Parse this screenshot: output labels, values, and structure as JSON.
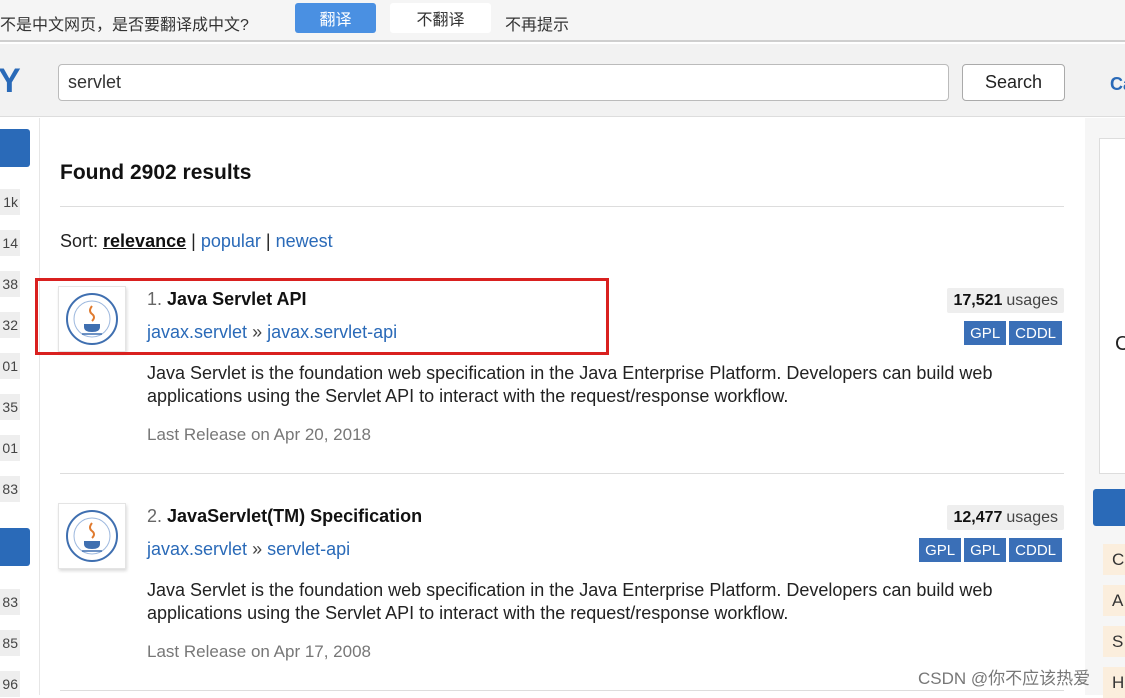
{
  "translate_bar": {
    "prompt": "不是中文网页，是否要翻译成中文?",
    "translate_button": "翻译",
    "no_button": "不翻译",
    "never_label": "不再提示"
  },
  "header": {
    "logo_fragment": "Y",
    "search_value": "servlet",
    "search_button": "Search",
    "right_fragment": "Ca"
  },
  "left_sidebar": {
    "counts_group_1": [
      "1k",
      "14",
      "38",
      "32",
      "01",
      "35",
      "01",
      "83"
    ],
    "counts_group_2": [
      "83",
      "85",
      "96"
    ]
  },
  "results_header": {
    "found": "Found 2902 results",
    "sort_label": "Sort:",
    "sort_active": "relevance",
    "sort_popular": "popular",
    "sort_newest": "newest",
    "sep": "|"
  },
  "results": [
    {
      "number": "1.",
      "title": "Java Servlet API",
      "group": "javax.servlet",
      "arrow": "»",
      "artifact": "javax.servlet-api",
      "description": "Java Servlet is the foundation web specification in the Java Enterprise Platform. Developers can build web applications using the Servlet API to interact with the request/response workflow.",
      "last_release": "Last Release on Apr 20, 2018",
      "usages_count": "17,521",
      "usages_label": "usages",
      "licenses": [
        "GPL",
        "CDDL"
      ]
    },
    {
      "number": "2.",
      "title": "JavaServlet(TM) Specification",
      "group": "javax.servlet",
      "arrow": "»",
      "artifact": "servlet-api",
      "description": "Java Servlet is the foundation web specification in the Java Enterprise Platform. Developers can build web applications using the Servlet API to interact with the request/response workflow.",
      "last_release": "Last Release on Apr 17, 2008",
      "usages_count": "12,477",
      "usages_label": "usages",
      "licenses": [
        "GPL",
        "GPL",
        "CDDL"
      ]
    }
  ],
  "right_sidebar": {
    "ad_fragment": "C",
    "tags": [
      "C",
      "A",
      "S",
      "H"
    ]
  },
  "watermark": "CSDN @你不应该热爱",
  "colors": {
    "brand_blue": "#2a6ab8",
    "translate_blue": "#4a90e2",
    "license_blue": "#3a6fb7",
    "highlight_red": "#d9201f"
  }
}
